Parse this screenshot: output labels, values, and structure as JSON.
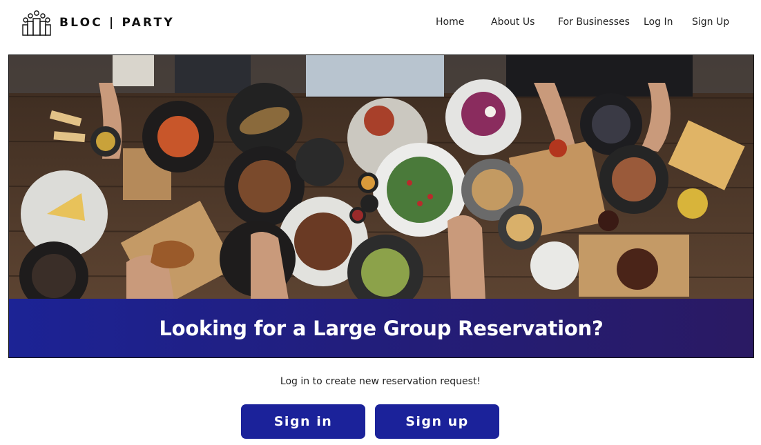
{
  "brand": {
    "name": "BLOC | PARTY",
    "logo_icon": "group-people-icon"
  },
  "nav": {
    "items": [
      {
        "label": "Home"
      },
      {
        "label": "About Us"
      },
      {
        "label": "For Businesses"
      },
      {
        "label": "Log In"
      },
      {
        "label": "Sign Up"
      }
    ]
  },
  "hero": {
    "image": "overhead-food-table-photo",
    "headline": "Looking for a Large Group Reservation?"
  },
  "cta": {
    "prompt": "Log in to create new reservation request!",
    "signin_label": "Sign in",
    "signup_label": "Sign up"
  },
  "colors": {
    "banner": "#1c2395",
    "button": "#1b229a",
    "table_wood": "#5a4230"
  }
}
